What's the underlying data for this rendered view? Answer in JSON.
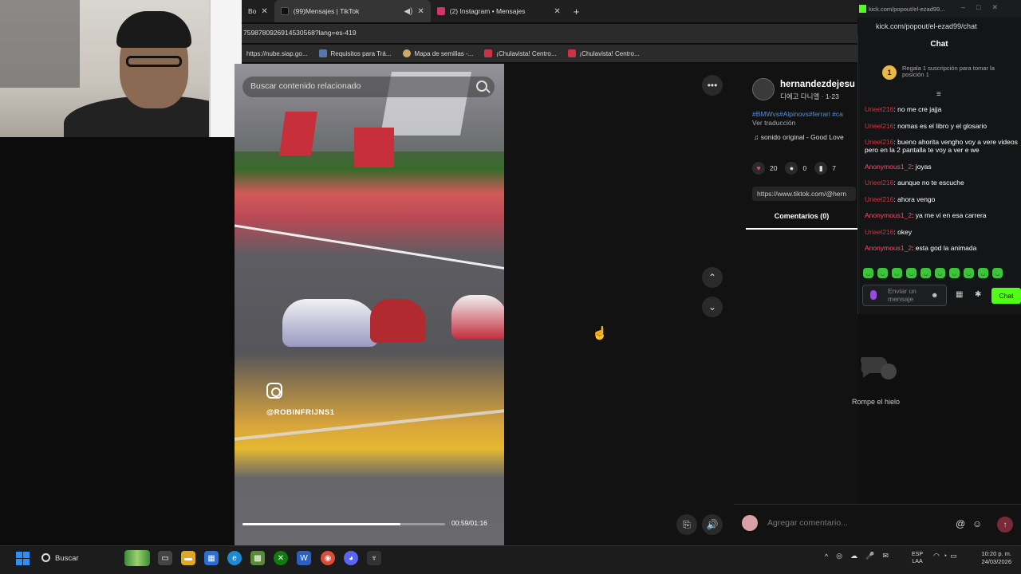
{
  "browser": {
    "tabs": [
      {
        "label": "Bo",
        "active": false
      },
      {
        "label": "(99)Mensajes | TikTok",
        "active": true
      },
      {
        "label": "(2) Instagram • Mensajes",
        "active": false
      }
    ],
    "new_tab": "+",
    "url": "7598780926914530568?lang=es-419",
    "bookmarks": [
      "https://nube.siap.go...",
      "Requisitos para Trá...",
      "Mapa de semillas -...",
      "¡Chulavista! Centro...",
      "¡Chulavista! Centro..."
    ]
  },
  "video": {
    "search_placeholder": "Buscar contenido relacionado",
    "watermark": "@ROBINFRIJNS1",
    "timecode": "00:59/01:16",
    "progress": 0.78
  },
  "middle": {
    "more": "•••",
    "up": "⌃",
    "down": "⌄",
    "captions": "⎘",
    "volume": "🔊"
  },
  "post": {
    "username": "hernandezdejesu",
    "handle": "디에고 다니엘 · 1-23",
    "hashtags": "#BMWvs#Alpinovs#ferrari #ca",
    "translate": "Ver traducción",
    "sound": "♫  sonido original - Good Love",
    "likes": "20",
    "comments": "0",
    "saves": "7",
    "link": "https://www.tiktok.com/@hern",
    "comments_tab": "Comentarios (0)",
    "empty_text": "Rompe el hielo",
    "comment_placeholder": "Agregar comentario...",
    "at": "@",
    "emoji": "☺",
    "send": "↑"
  },
  "kick": {
    "window_title": "kick.com/popout/el-ezad99...",
    "window_controls": "–□✕",
    "url": "kick.com/popout/el-ezad99/chat",
    "chat_title": "Chat",
    "gift_badge": "1",
    "gift_text": "Regala 1 suscripción para tomar la posición 1",
    "pin": "≡",
    "messages": [
      {
        "user": "Urieel216",
        "color": "#e0303a",
        "text": ": no me cre jajja"
      },
      {
        "user": "Urieel216",
        "color": "#e0303a",
        "text": ": nomas es el libro y el glosario"
      },
      {
        "user": "Urieel216",
        "color": "#e0303a",
        "text": ": bueno ahorita vengho voy a vere videos pero en la 2 pantalla te voy a ver e we"
      },
      {
        "user": "Anonymous1_2",
        "color": "#ff4a6a",
        "text": ": joyas"
      },
      {
        "user": "Urieel216",
        "color": "#e0303a",
        "text": ": aunque no te escuche"
      },
      {
        "user": "Urieel216",
        "color": "#e0303a",
        "text": ": ahora vengo"
      },
      {
        "user": "Anonymous1_2",
        "color": "#ff4a6a",
        "text": ": ya me vi en esa carrera"
      },
      {
        "user": "Urieel216",
        "color": "#e0303a",
        "text": ": okey"
      },
      {
        "user": "Anonymous1_2",
        "color": "#ff4a6a",
        "text": ": esta god la animada"
      }
    ],
    "input_placeholder": "Enviar un mensaje",
    "emoji": "☻",
    "store": "▦",
    "gear": "✱",
    "send_label": "Chat",
    "accent": "#53fc18"
  },
  "taskbar": {
    "search": "Buscar",
    "lang": "ESP\nLAA",
    "time": "10:20 p. m.",
    "date": "24/03/2026",
    "tray": [
      "^",
      "◎",
      "☁",
      "🎤",
      "✉"
    ]
  }
}
